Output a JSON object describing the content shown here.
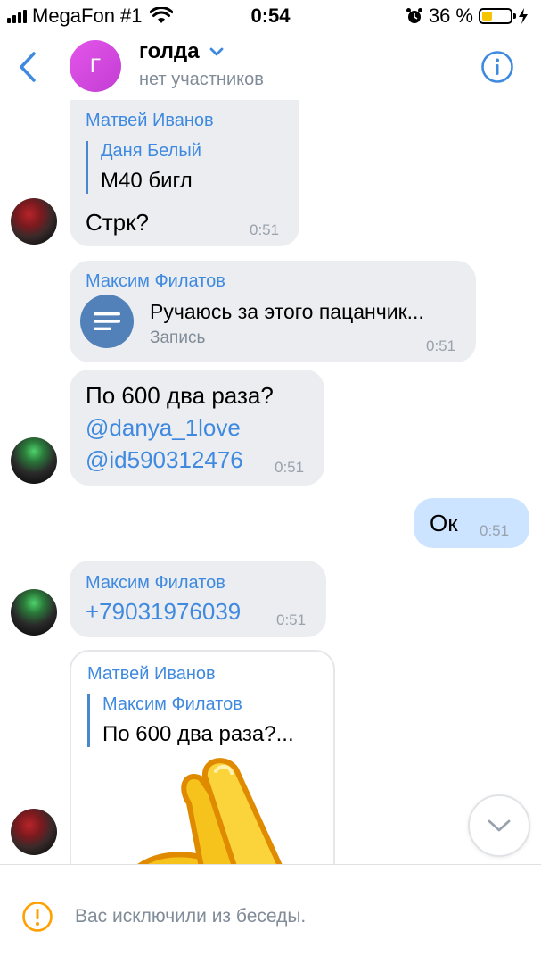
{
  "status_bar": {
    "carrier": "MegaFon #1",
    "time": "0:54",
    "battery_percent": "36 %",
    "battery_level": 0.36,
    "icons": [
      "signal-icon",
      "wifi-icon",
      "alarm-icon",
      "battery-icon",
      "charging-icon"
    ]
  },
  "header": {
    "avatar_letter": "Г",
    "title": "голда",
    "subtitle": "нет участников",
    "icons": [
      "back-icon",
      "chevron-down-icon",
      "info-icon"
    ]
  },
  "messages": [
    {
      "sender": "Матвей Иванов",
      "reply_sender": "Даня Белый",
      "reply_text": "М40 бигл",
      "text": "Стрк?",
      "time": "0:51"
    },
    {
      "sender": "Максим Филатов",
      "doc_title": "Ручаюсь за этого пацанчик...",
      "doc_subtitle": "Запись",
      "time": "0:51"
    },
    {
      "line1": "По 600 два раза?",
      "line2": "@danya_1love",
      "line3": "@id590312476",
      "time": "0:51"
    },
    {
      "text": "Ок",
      "time": "0:51"
    },
    {
      "sender": "Максим Филатов",
      "text": "+79031976039",
      "time": "0:51"
    },
    {
      "sender": "Матвей Иванов",
      "reply_sender": "Максим Филатов",
      "reply_text": "По 600 два раза?..."
    }
  ],
  "footer": {
    "notice": "Вас исключили из беседы."
  },
  "colors": {
    "accent": "#3f8ae0",
    "incoming_bubble": "#ebedf0",
    "outgoing_bubble": "#cce4ff",
    "avatar_purple": "#d04ae0",
    "warning": "#ffa000"
  }
}
